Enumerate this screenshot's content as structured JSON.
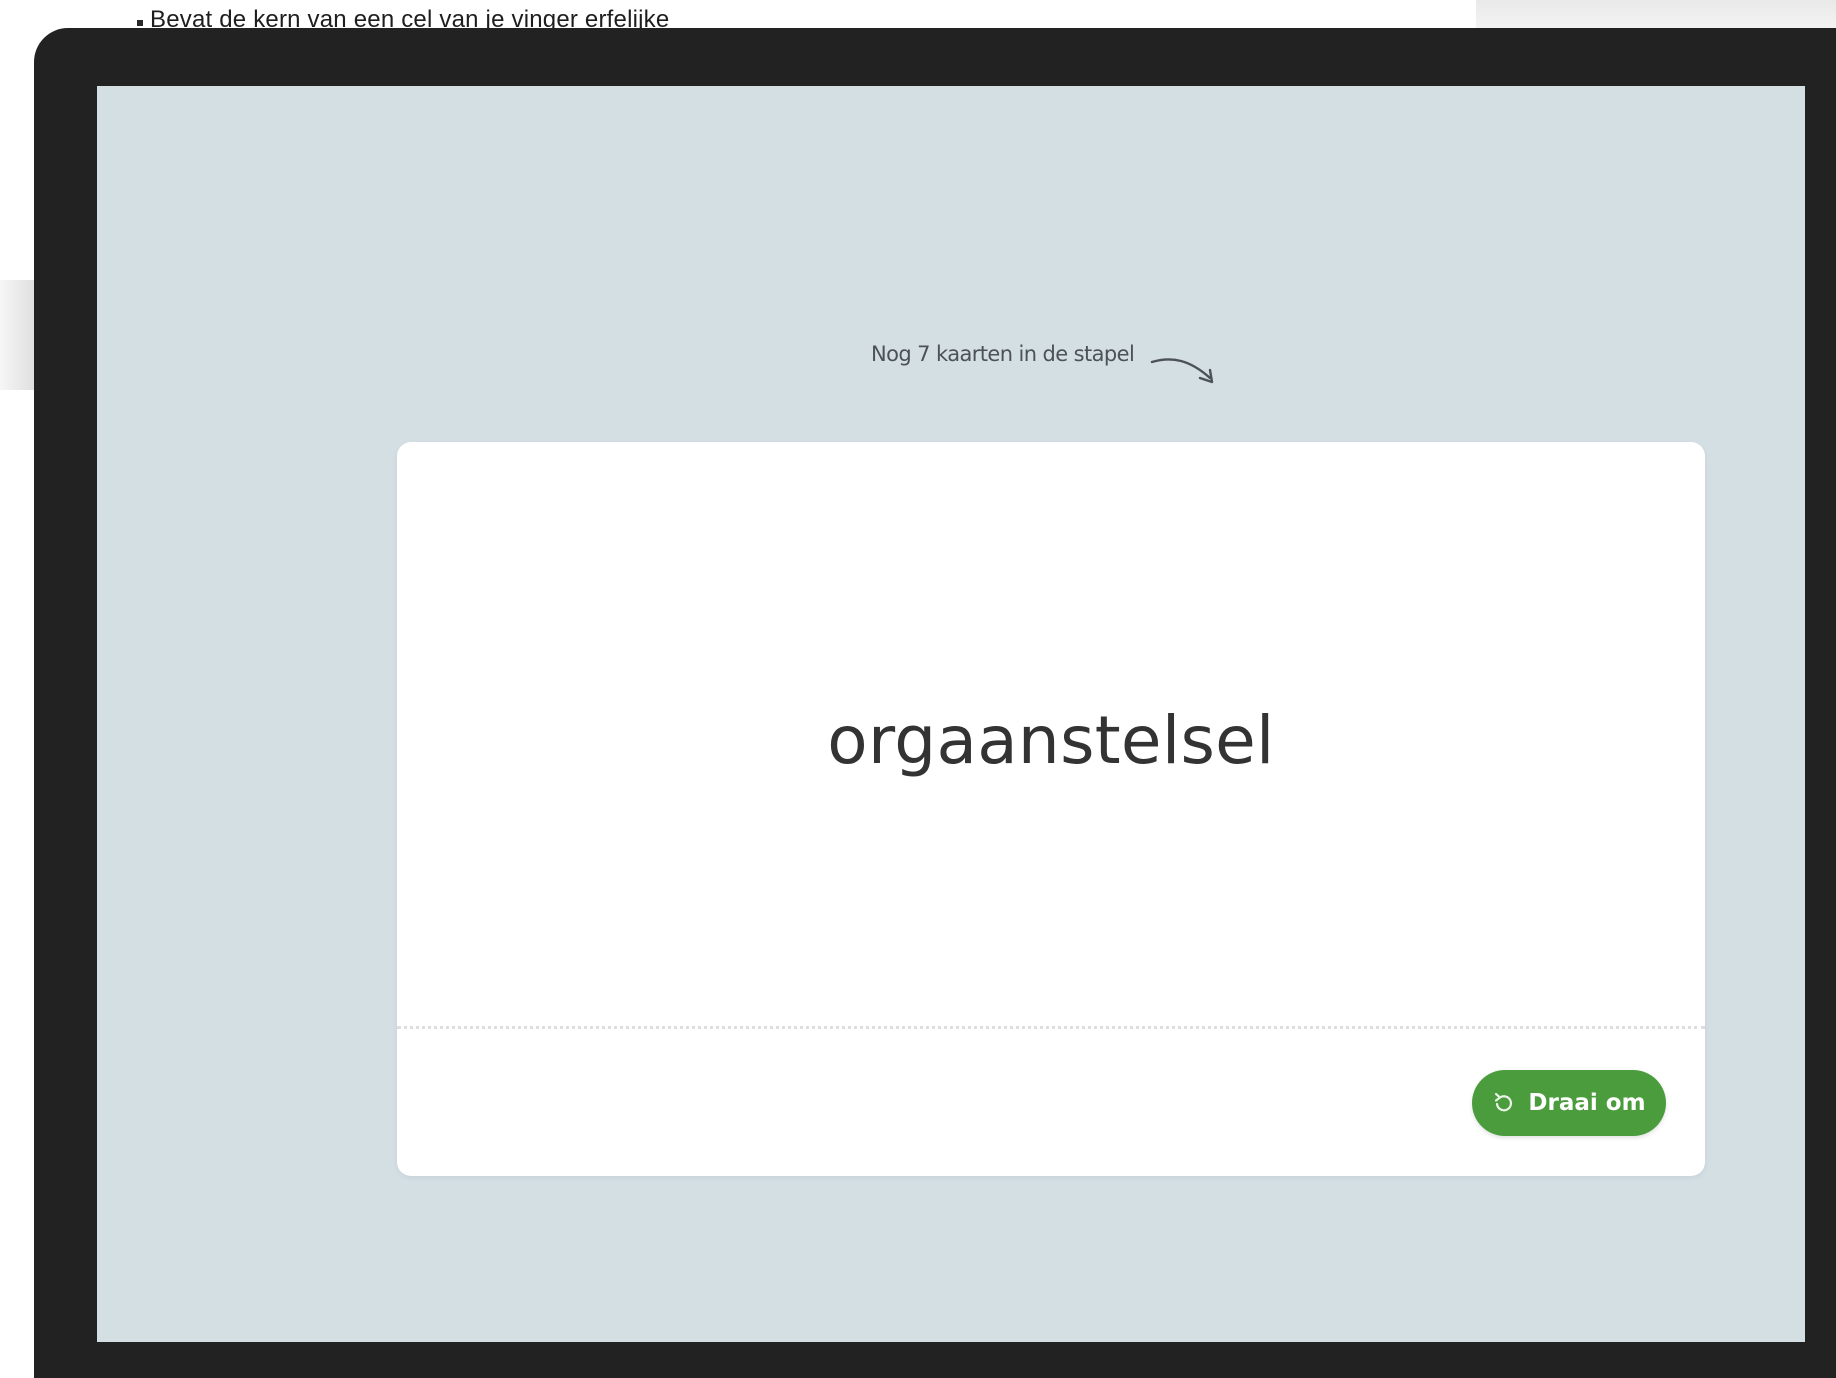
{
  "document": {
    "visible_line": "Bevat de kern van een cel van je vinger erfelijke"
  },
  "flashcard_app": {
    "stack_hint": "Nog 7 kaarten in de stapel",
    "remaining_cards": 7,
    "card": {
      "term": "orgaanstelsel"
    },
    "flip_button": {
      "label": "Draai om",
      "icon": "flip-icon"
    }
  },
  "colors": {
    "screen_background": "#d4dfe4",
    "card_background": "#ffffff",
    "button_green": "#4a9c3d",
    "device_bezel": "#222222"
  }
}
